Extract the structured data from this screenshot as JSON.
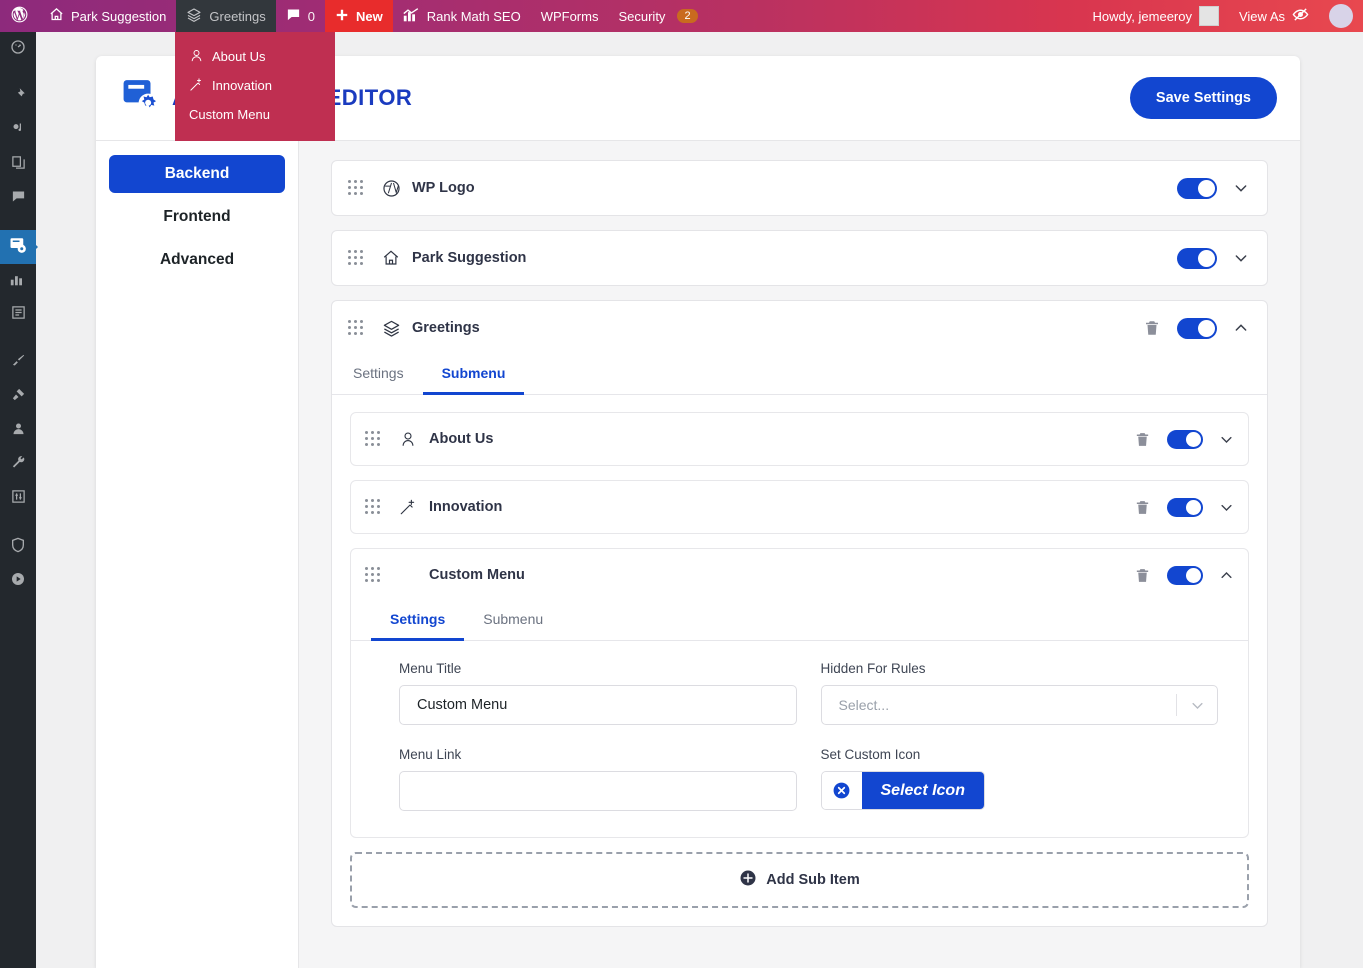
{
  "adminbar": {
    "wp_logo": "wordpress-icon",
    "site_name": "Park Suggestion",
    "greetings": "Greetings",
    "comments_count": "0",
    "new_label": "New",
    "rank_math": "Rank Math SEO",
    "wpforms": "WPForms",
    "security": "Security",
    "security_badge": "2",
    "howdy": "Howdy, jemeeroy",
    "view_as": "View As",
    "dropdown": [
      {
        "label": "About Us",
        "icon": "user-outline-icon"
      },
      {
        "label": "Innovation",
        "icon": "magic-wand-icon"
      },
      {
        "label": "Custom Menu",
        "icon": "none"
      }
    ]
  },
  "sidebar": {
    "items": [
      {
        "name": "dashboard-icon"
      },
      {
        "name": "pin-icon"
      },
      {
        "name": "media-icon"
      },
      {
        "name": "pages-icon"
      },
      {
        "name": "comments-icon"
      },
      {
        "name": "admin-menu-editor-icon"
      },
      {
        "name": "analytics-icon"
      },
      {
        "name": "forms-icon"
      },
      {
        "name": "brush-icon"
      },
      {
        "name": "plugins-icon"
      },
      {
        "name": "users-icon"
      },
      {
        "name": "tools-icon"
      },
      {
        "name": "settings-sliders-icon"
      },
      {
        "name": "shield-icon"
      },
      {
        "name": "play-icon"
      }
    ]
  },
  "header": {
    "logo": "admin-menu-editor-logo",
    "title": "ADMIN MENU EDITOR",
    "save_label": "Save Settings"
  },
  "leftnav": {
    "tabs": [
      {
        "label": "Backend",
        "active": true
      },
      {
        "label": "Frontend",
        "active": false
      },
      {
        "label": "Advanced",
        "active": false
      }
    ]
  },
  "menu_items": [
    {
      "label": "WP Logo",
      "icon": "wordpress-icon",
      "enabled": true,
      "expanded": false
    },
    {
      "label": "Park Suggestion",
      "icon": "home-icon",
      "enabled": true,
      "expanded": false
    },
    {
      "label": "Greetings",
      "icon": "layers-icon",
      "enabled": true,
      "expanded": true
    }
  ],
  "greetings": {
    "tabs": [
      {
        "label": "Settings",
        "active": false
      },
      {
        "label": "Submenu",
        "active": true
      }
    ],
    "submenu_items": [
      {
        "label": "About Us",
        "icon": "user-outline-icon",
        "enabled": true,
        "expanded": false
      },
      {
        "label": "Innovation",
        "icon": "magic-wand-icon",
        "enabled": true,
        "expanded": false
      },
      {
        "label": "Custom Menu",
        "icon": "none",
        "enabled": true,
        "expanded": true
      }
    ],
    "add_sub_item": "Add Sub Item"
  },
  "custom_menu": {
    "tabs": [
      {
        "label": "Settings",
        "active": true
      },
      {
        "label": "Submenu",
        "active": false
      }
    ],
    "fields": {
      "menu_title_label": "Menu Title",
      "menu_title_value": "Custom Menu",
      "hidden_rules_label": "Hidden For Rules",
      "hidden_rules_placeholder": "Select...",
      "menu_link_label": "Menu Link",
      "menu_link_value": "",
      "menu_link_placeholder": "",
      "custom_icon_label": "Set Custom Icon",
      "select_icon_label": "Select Icon"
    }
  },
  "colors": {
    "accent_blue": "#1246d0",
    "adminbar_purple": "#8d2a7c",
    "adminbar_red": "#e8484f",
    "dropdown_bg": "#bf2f51",
    "sidebar_bg": "#23282d"
  }
}
